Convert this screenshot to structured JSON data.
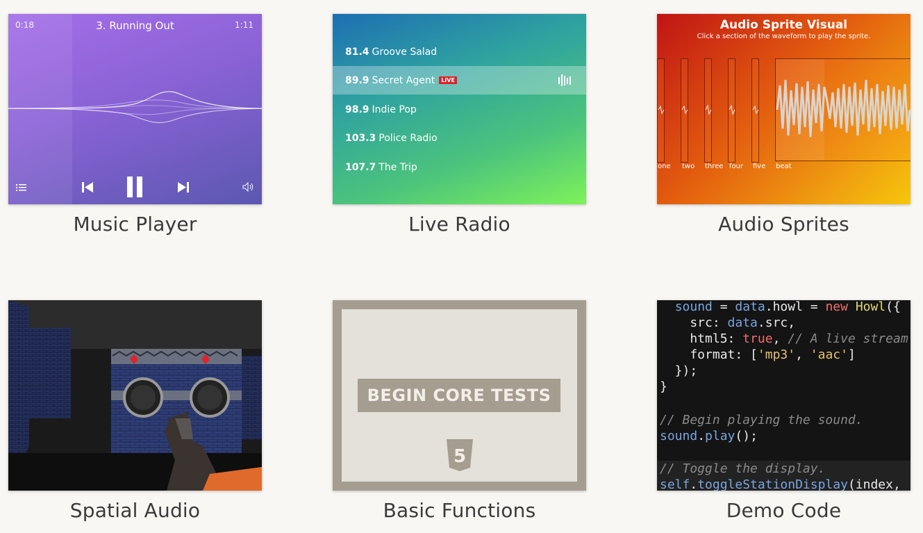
{
  "cards": [
    {
      "caption": "Music Player"
    },
    {
      "caption": "Live Radio"
    },
    {
      "caption": "Audio Sprites"
    },
    {
      "caption": "Spatial Audio"
    },
    {
      "caption": "Basic Functions"
    },
    {
      "caption": "Demo Code"
    }
  ],
  "music_player": {
    "elapsed": "0:18",
    "track": "3. Running Out",
    "duration": "1:11",
    "icons": [
      "playlist-icon",
      "previous-icon",
      "pause-icon",
      "next-icon",
      "volume-icon"
    ]
  },
  "live_radio": {
    "stations": [
      {
        "freq": "81.4",
        "name": "Groove Salad"
      },
      {
        "freq": "89.9",
        "name": "Secret Agent"
      },
      {
        "freq": "98.9",
        "name": "Indie Pop"
      },
      {
        "freq": "103.3",
        "name": "Police Radio"
      },
      {
        "freq": "107.7",
        "name": "The Trip"
      }
    ],
    "live_badge": "LIVE"
  },
  "audio_sprites": {
    "title": "Audio Sprite Visual",
    "subtitle": "Click a section of the waveform to play the sprite.",
    "labels": [
      "one",
      "two",
      "three",
      "four",
      "five",
      "beat"
    ]
  },
  "basic_functions": {
    "button": "BEGIN CORE TESTS",
    "badge": "5"
  },
  "demo_code": {
    "lines": [
      "  sound = data.howl = new Howl({",
      "    src: data.src,",
      "    html5: true, // A live stream",
      "    format: ['mp3', 'aac']",
      "  });",
      "}",
      "",
      "// Begin playing the sound.",
      "sound.play();",
      "",
      "// Toggle the display.",
      "self.toggleStationDisplay(index,"
    ]
  }
}
